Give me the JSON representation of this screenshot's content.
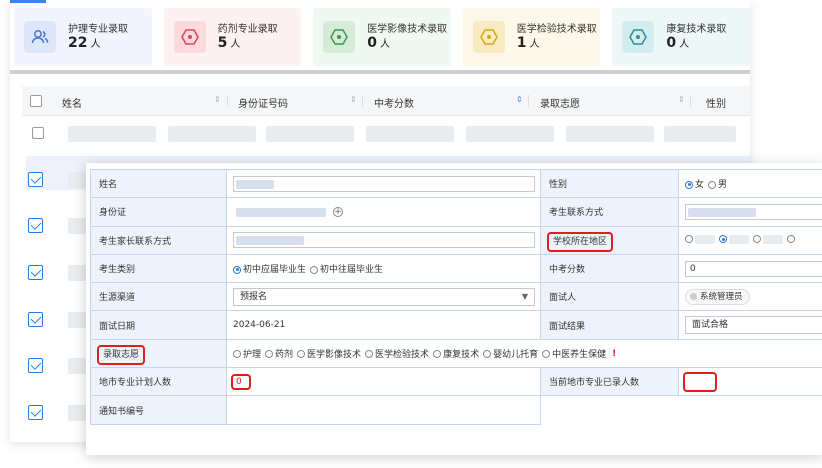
{
  "stats": [
    {
      "label": "护理专业录取",
      "value": "22",
      "unit": "人",
      "bg": "#f2f5fd",
      "icon_bg": "#dde6fb",
      "icon_color": "#4a72c9",
      "icon": "users-icon"
    },
    {
      "label": "药剂专业录取",
      "value": "5",
      "unit": "人",
      "bg": "#fdf1f2",
      "icon_bg": "#fbd9dd",
      "icon_color": "#d9475a",
      "icon": "hexagon-icon"
    },
    {
      "label": "医学影像技术录取",
      "value": "0",
      "unit": "人",
      "bg": "#eff8f1",
      "icon_bg": "#d5ecd9",
      "icon_color": "#3a9a52",
      "icon": "hexagon-icon"
    },
    {
      "label": "医学检验技术录取",
      "value": "1",
      "unit": "人",
      "bg": "#fdf8ea",
      "icon_bg": "#f8ebc2",
      "icon_color": "#d9a713",
      "icon": "hexagon-icon"
    },
    {
      "label": "康复技术录取",
      "value": "0",
      "unit": "人",
      "bg": "#eef7f8",
      "icon_bg": "#d3ecee",
      "icon_color": "#2c8f99",
      "icon": "hexagon-icon"
    }
  ],
  "table": {
    "columns": [
      "姓名",
      "身份证号码",
      "中考分数",
      "录取志愿",
      "性别"
    ]
  },
  "form": {
    "name_label": "姓名",
    "gender_label": "性别",
    "gender_options": [
      "女",
      "男"
    ],
    "idcard_label": "身份证",
    "contact_label": "考生联系方式",
    "parent_contact_label": "考生家长联系方式",
    "school_region_label": "学校所在地区",
    "category_label": "考生类别",
    "category_options": [
      "初中应届毕业生",
      "初中往届毕业生"
    ],
    "score_label": "中考分数",
    "score_value": "0",
    "channel_label": "生源渠道",
    "channel_value": "预报名",
    "interviewer_label": "面试人",
    "interviewer_value": "系统管理员",
    "interview_date_label": "面试日期",
    "interview_date_value": "2024-06-21",
    "interview_result_label": "面试结果",
    "interview_result_value": "面试合格",
    "preference_label": "录取志愿",
    "preference_options": [
      "护理",
      "药剂",
      "医学影像技术",
      "医学检验技术",
      "康复技术",
      "婴幼儿托育",
      "中医养生保健"
    ],
    "preference_required_mark": "!",
    "plan_count_label": "地市专业计划人数",
    "plan_count_value": "0",
    "admitted_count_label": "当前地市专业已录人数",
    "admitted_count_value": "",
    "notice_label": "通知书编号"
  },
  "colors": {
    "accent": "#3b82f6",
    "highlight": "#e01e1e",
    "label_bg": "#eef3fb"
  }
}
